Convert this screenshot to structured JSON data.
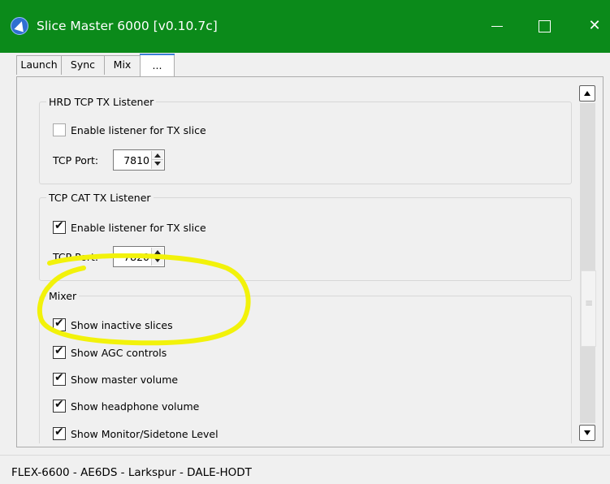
{
  "window": {
    "title": "Slice Master 6000 [v0.10.7c]",
    "minimize_glyph": "",
    "maximize_glyph": "",
    "close_glyph": "✕"
  },
  "tabs": [
    {
      "label": "Launch",
      "active": false
    },
    {
      "label": "Sync",
      "active": false
    },
    {
      "label": "Mix",
      "active": false
    },
    {
      "label": "...",
      "active": true
    }
  ],
  "groups": {
    "hrd": {
      "title": "HRD TCP TX Listener",
      "enable_label": "Enable  listener for TX slice",
      "enabled": false,
      "port_label": "TCP Port:",
      "port_value": "7810"
    },
    "cat": {
      "title": "TCP CAT TX Listener",
      "enable_label": "Enable  listener for TX slice",
      "enabled": true,
      "port_label": "TCP Port:",
      "port_value": "7820"
    },
    "mixer": {
      "title": "Mixer",
      "items": [
        {
          "label": "Show inactive slices",
          "checked": true
        },
        {
          "label": "Show AGC controls",
          "checked": true
        },
        {
          "label": "Show master volume",
          "checked": true
        },
        {
          "label": "Show headphone volume",
          "checked": true
        },
        {
          "label": "Show Monitor/Sidetone Level",
          "checked": true
        }
      ]
    }
  },
  "annotation": {
    "color": "#f2f20a"
  },
  "status_bar": {
    "text": "FLEX-6600 - AE6DS - Larkspur - DALE-HODT"
  },
  "colors": {
    "titlebar": "#0b8a1a",
    "tab_accent": "#3c7fd6"
  }
}
